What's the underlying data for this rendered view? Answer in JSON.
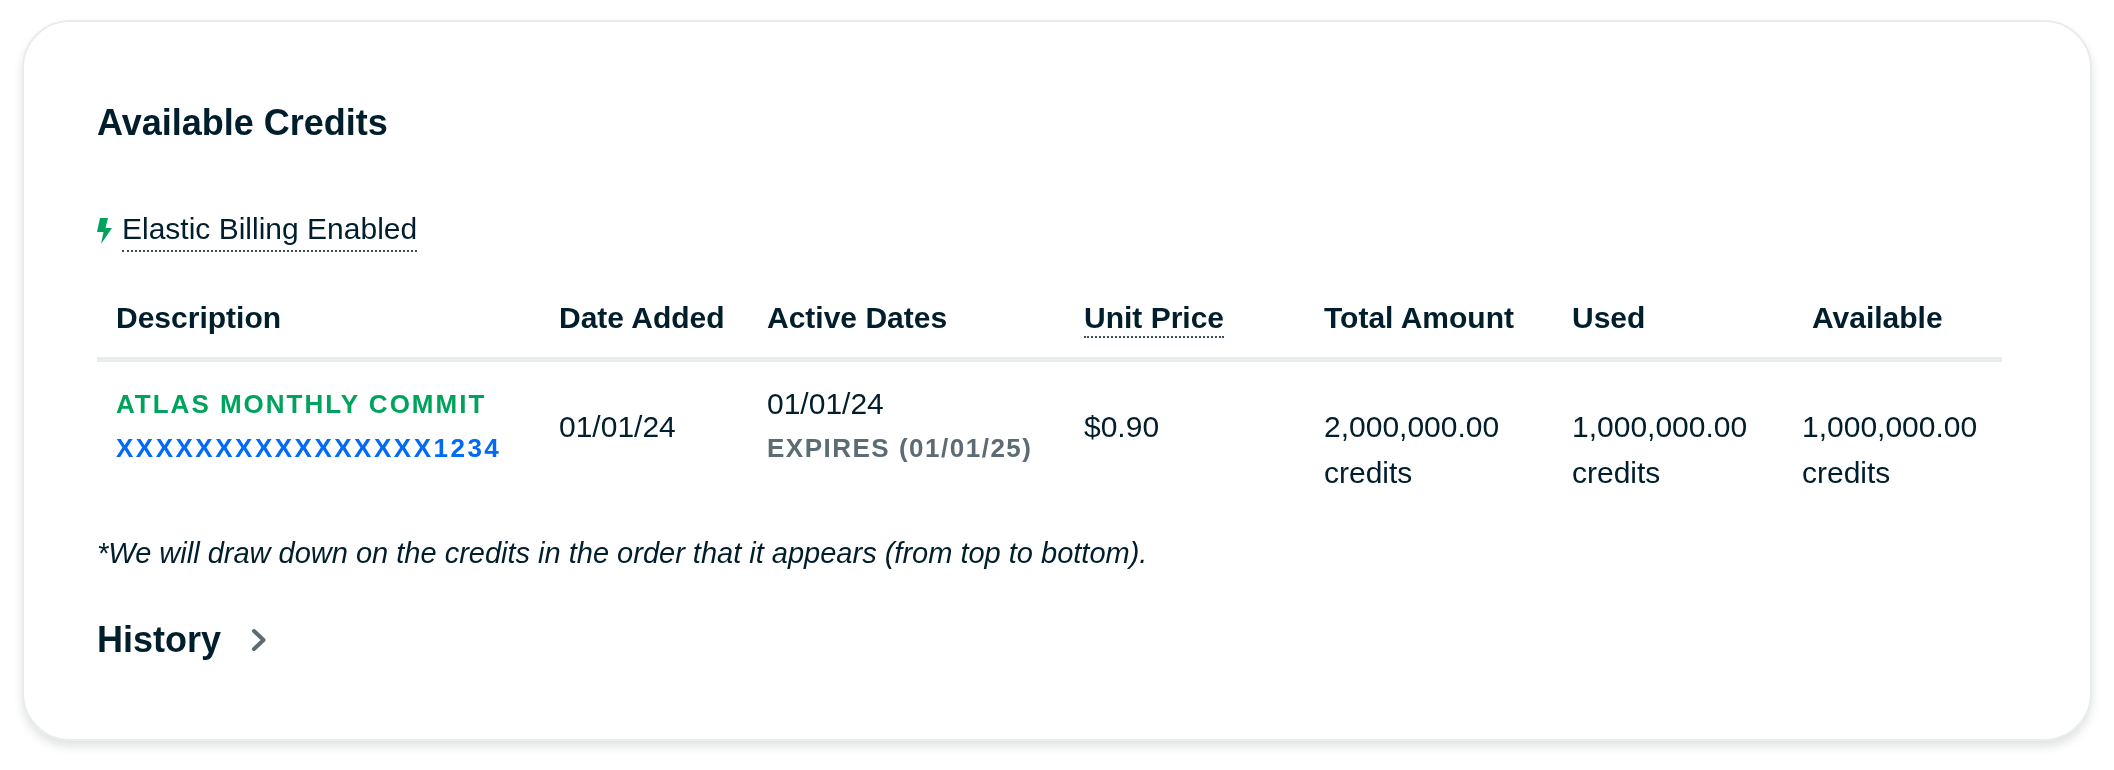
{
  "card": {
    "title": "Available Credits"
  },
  "elastic_billing": {
    "label": "Elastic Billing Enabled"
  },
  "table": {
    "columns": [
      {
        "label": "Description",
        "tooltip": false
      },
      {
        "label": "Date Added",
        "tooltip": false
      },
      {
        "label": "Active Dates",
        "tooltip": false
      },
      {
        "label": "Unit Price",
        "tooltip": true
      },
      {
        "label": "Total Amount",
        "tooltip": false
      },
      {
        "label": "Used",
        "tooltip": false
      },
      {
        "label": "Available",
        "tooltip": false
      }
    ],
    "rows": [
      {
        "cells": [
          {
            "kind": "description",
            "name": "ATLAS MONTHLY COMMIT",
            "number": "XXXXXXXXXXXXXXXX1234"
          },
          {
            "kind": "text",
            "text": "01/01/24"
          },
          {
            "kind": "dates",
            "start": "01/01/24",
            "expires": "EXPIRES (01/01/25)"
          },
          {
            "kind": "text",
            "text": "$0.90"
          },
          {
            "kind": "text",
            "text": "2,000,000.00 credits"
          },
          {
            "kind": "text",
            "text": "1,000,000.00 credits"
          },
          {
            "kind": "text",
            "text": "1,000,000.00 credits"
          }
        ]
      }
    ]
  },
  "footnote": "*We will draw down on the credits in the order that it appears (from top to bottom).",
  "history": {
    "label": "History"
  }
}
